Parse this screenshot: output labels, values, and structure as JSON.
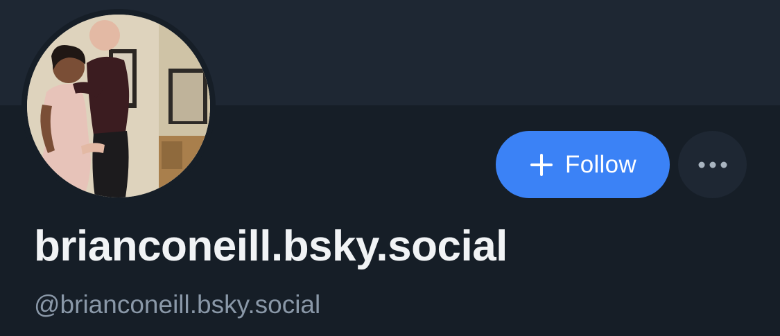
{
  "profile": {
    "display_name": "brianconeill.bsky.social",
    "handle": "@brianconeill.bsky.social",
    "avatar_alt": "profile photo"
  },
  "actions": {
    "follow_label": "Follow",
    "follow_icon": "plus-icon",
    "more_icon": "ellipsis-icon"
  },
  "colors": {
    "background": "#161e27",
    "banner": "#1e2733",
    "accent": "#3b82f6",
    "text_primary": "#f1f3f5",
    "text_secondary": "#8a98a8"
  }
}
